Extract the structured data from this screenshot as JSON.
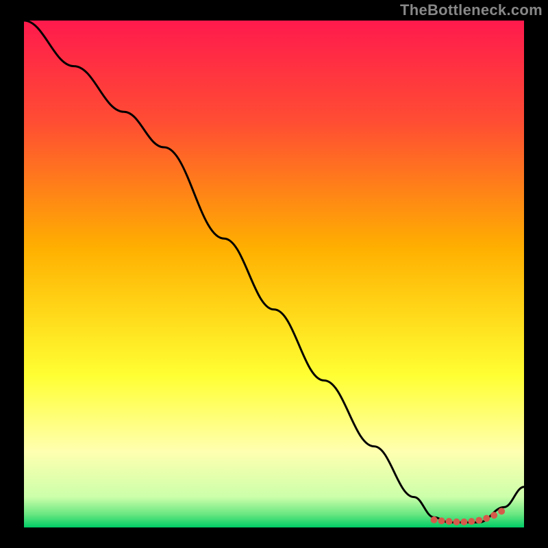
{
  "attribution": "TheBottleneck.com",
  "chart_data": {
    "type": "line",
    "title": "",
    "xlabel": "",
    "ylabel": "",
    "xlim": [
      0,
      100
    ],
    "ylim": [
      0,
      100
    ],
    "background_gradient": {
      "stops": [
        {
          "offset": 0.0,
          "color": "#ff1a4d"
        },
        {
          "offset": 0.2,
          "color": "#ff4d33"
        },
        {
          "offset": 0.45,
          "color": "#ffb000"
        },
        {
          "offset": 0.7,
          "color": "#ffff33"
        },
        {
          "offset": 0.85,
          "color": "#ffffb0"
        },
        {
          "offset": 0.94,
          "color": "#ccffaa"
        },
        {
          "offset": 0.975,
          "color": "#66e680"
        },
        {
          "offset": 1.0,
          "color": "#00cc66"
        }
      ]
    },
    "curve": {
      "x": [
        0,
        10,
        20,
        28,
        40,
        50,
        60,
        70,
        78,
        82,
        85,
        88,
        91,
        96,
        100
      ],
      "y": [
        100,
        91,
        82,
        75,
        57,
        43,
        29,
        16,
        6,
        2,
        1,
        1,
        1,
        4,
        8
      ]
    },
    "markers": {
      "x": [
        82,
        83.5,
        85,
        86.5,
        88,
        89.5,
        91,
        92.5,
        94,
        95.5
      ],
      "y": [
        1.5,
        1.3,
        1.2,
        1.1,
        1.1,
        1.2,
        1.4,
        1.8,
        2.4,
        3.2
      ],
      "color": "#d65a4a",
      "radius": 5
    }
  }
}
